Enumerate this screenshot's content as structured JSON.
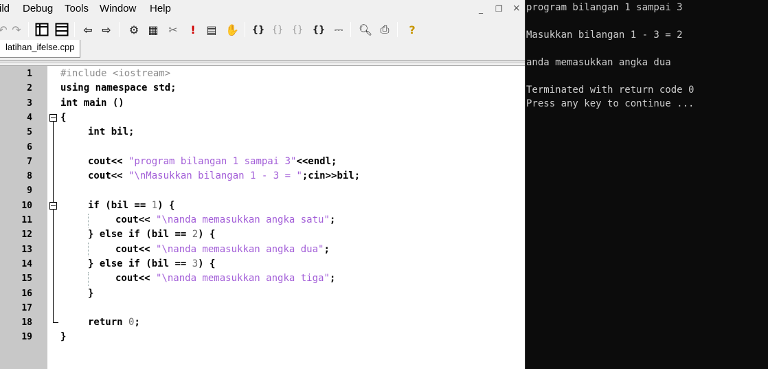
{
  "menu": {
    "items": [
      "ild",
      "Debug",
      "Tools",
      "Window",
      "Help"
    ]
  },
  "window_controls": {
    "minimize": "_",
    "restore": "Ὕ7",
    "close": "×"
  },
  "toolbar": {
    "icons": [
      "redo-icon",
      "toggle-panel-icon",
      "toggle-panel-icon",
      "back-arrow-icon",
      "forward-arrow-icon",
      "compile-icon",
      "run-icon",
      "rebuild-icon",
      "stop-icon",
      "debug-icon",
      "pause-icon",
      "step-into-icon",
      "step-over-icon",
      "step-out-icon",
      "run-to-cursor-icon",
      "chart-icon",
      "check-syntax-icon",
      "print-icon",
      "help-icon"
    ]
  },
  "tab": {
    "label": "latihan_ifelse.cpp"
  },
  "editor": {
    "line_numbers": [
      "1",
      "2",
      "3",
      "4",
      "5",
      "6",
      "7",
      "8",
      "9",
      "10",
      "11",
      "12",
      "13",
      "14",
      "15",
      "16",
      "17",
      "18",
      "19"
    ]
  },
  "code": {
    "l1_pp": "#include <iostream>",
    "l2_kw": "using namespace",
    "l2_rest": " std;",
    "l3_kw": "int",
    "l3_rest": " main ()",
    "l4": "{",
    "l5_kw": "int",
    "l5_rest": " bil;",
    "l7_a": "cout<<",
    "l7_str": " \"program bilangan 1 sampai 3\"",
    "l7_b": "<<endl;",
    "l8_a": "cout<<",
    "l8_str": " \"\\nMasukkan bilangan 1 - 3 = \"",
    "l8_b": ";cin>>bil;",
    "l10_kw": "if",
    "l10_rest": " (bil == ",
    "l10_num": "1",
    "l10_end": ") {",
    "l11_a": "cout<<",
    "l11_str": " \"\\nanda memasukkan angka satu\"",
    "l11_b": ";",
    "l12_a": "} ",
    "l12_kw": "else if",
    "l12_rest": " (bil == ",
    "l12_num": "2",
    "l12_end": ") {",
    "l13_a": "cout<<",
    "l13_str": " \"\\nanda memasukkan angka dua\"",
    "l13_b": ";",
    "l14_a": "} ",
    "l14_kw": "else if",
    "l14_rest": " (bil == ",
    "l14_num": "3",
    "l14_end": ") {",
    "l15_a": "cout<<",
    "l15_str": " \"\\nanda memasukkan angka tiga\"",
    "l15_b": ";",
    "l16": "}",
    "l18_kw": "return",
    "l18_num": " 0",
    "l18_end": ";",
    "l19": "}"
  },
  "console": {
    "lines": [
      "program bilangan 1 sampai 3",
      "",
      "Masukkan bilangan 1 - 3 = 2",
      "",
      "anda memasukkan angka dua",
      "",
      "Terminated with return code 0",
      "Press any key to continue ..."
    ]
  }
}
